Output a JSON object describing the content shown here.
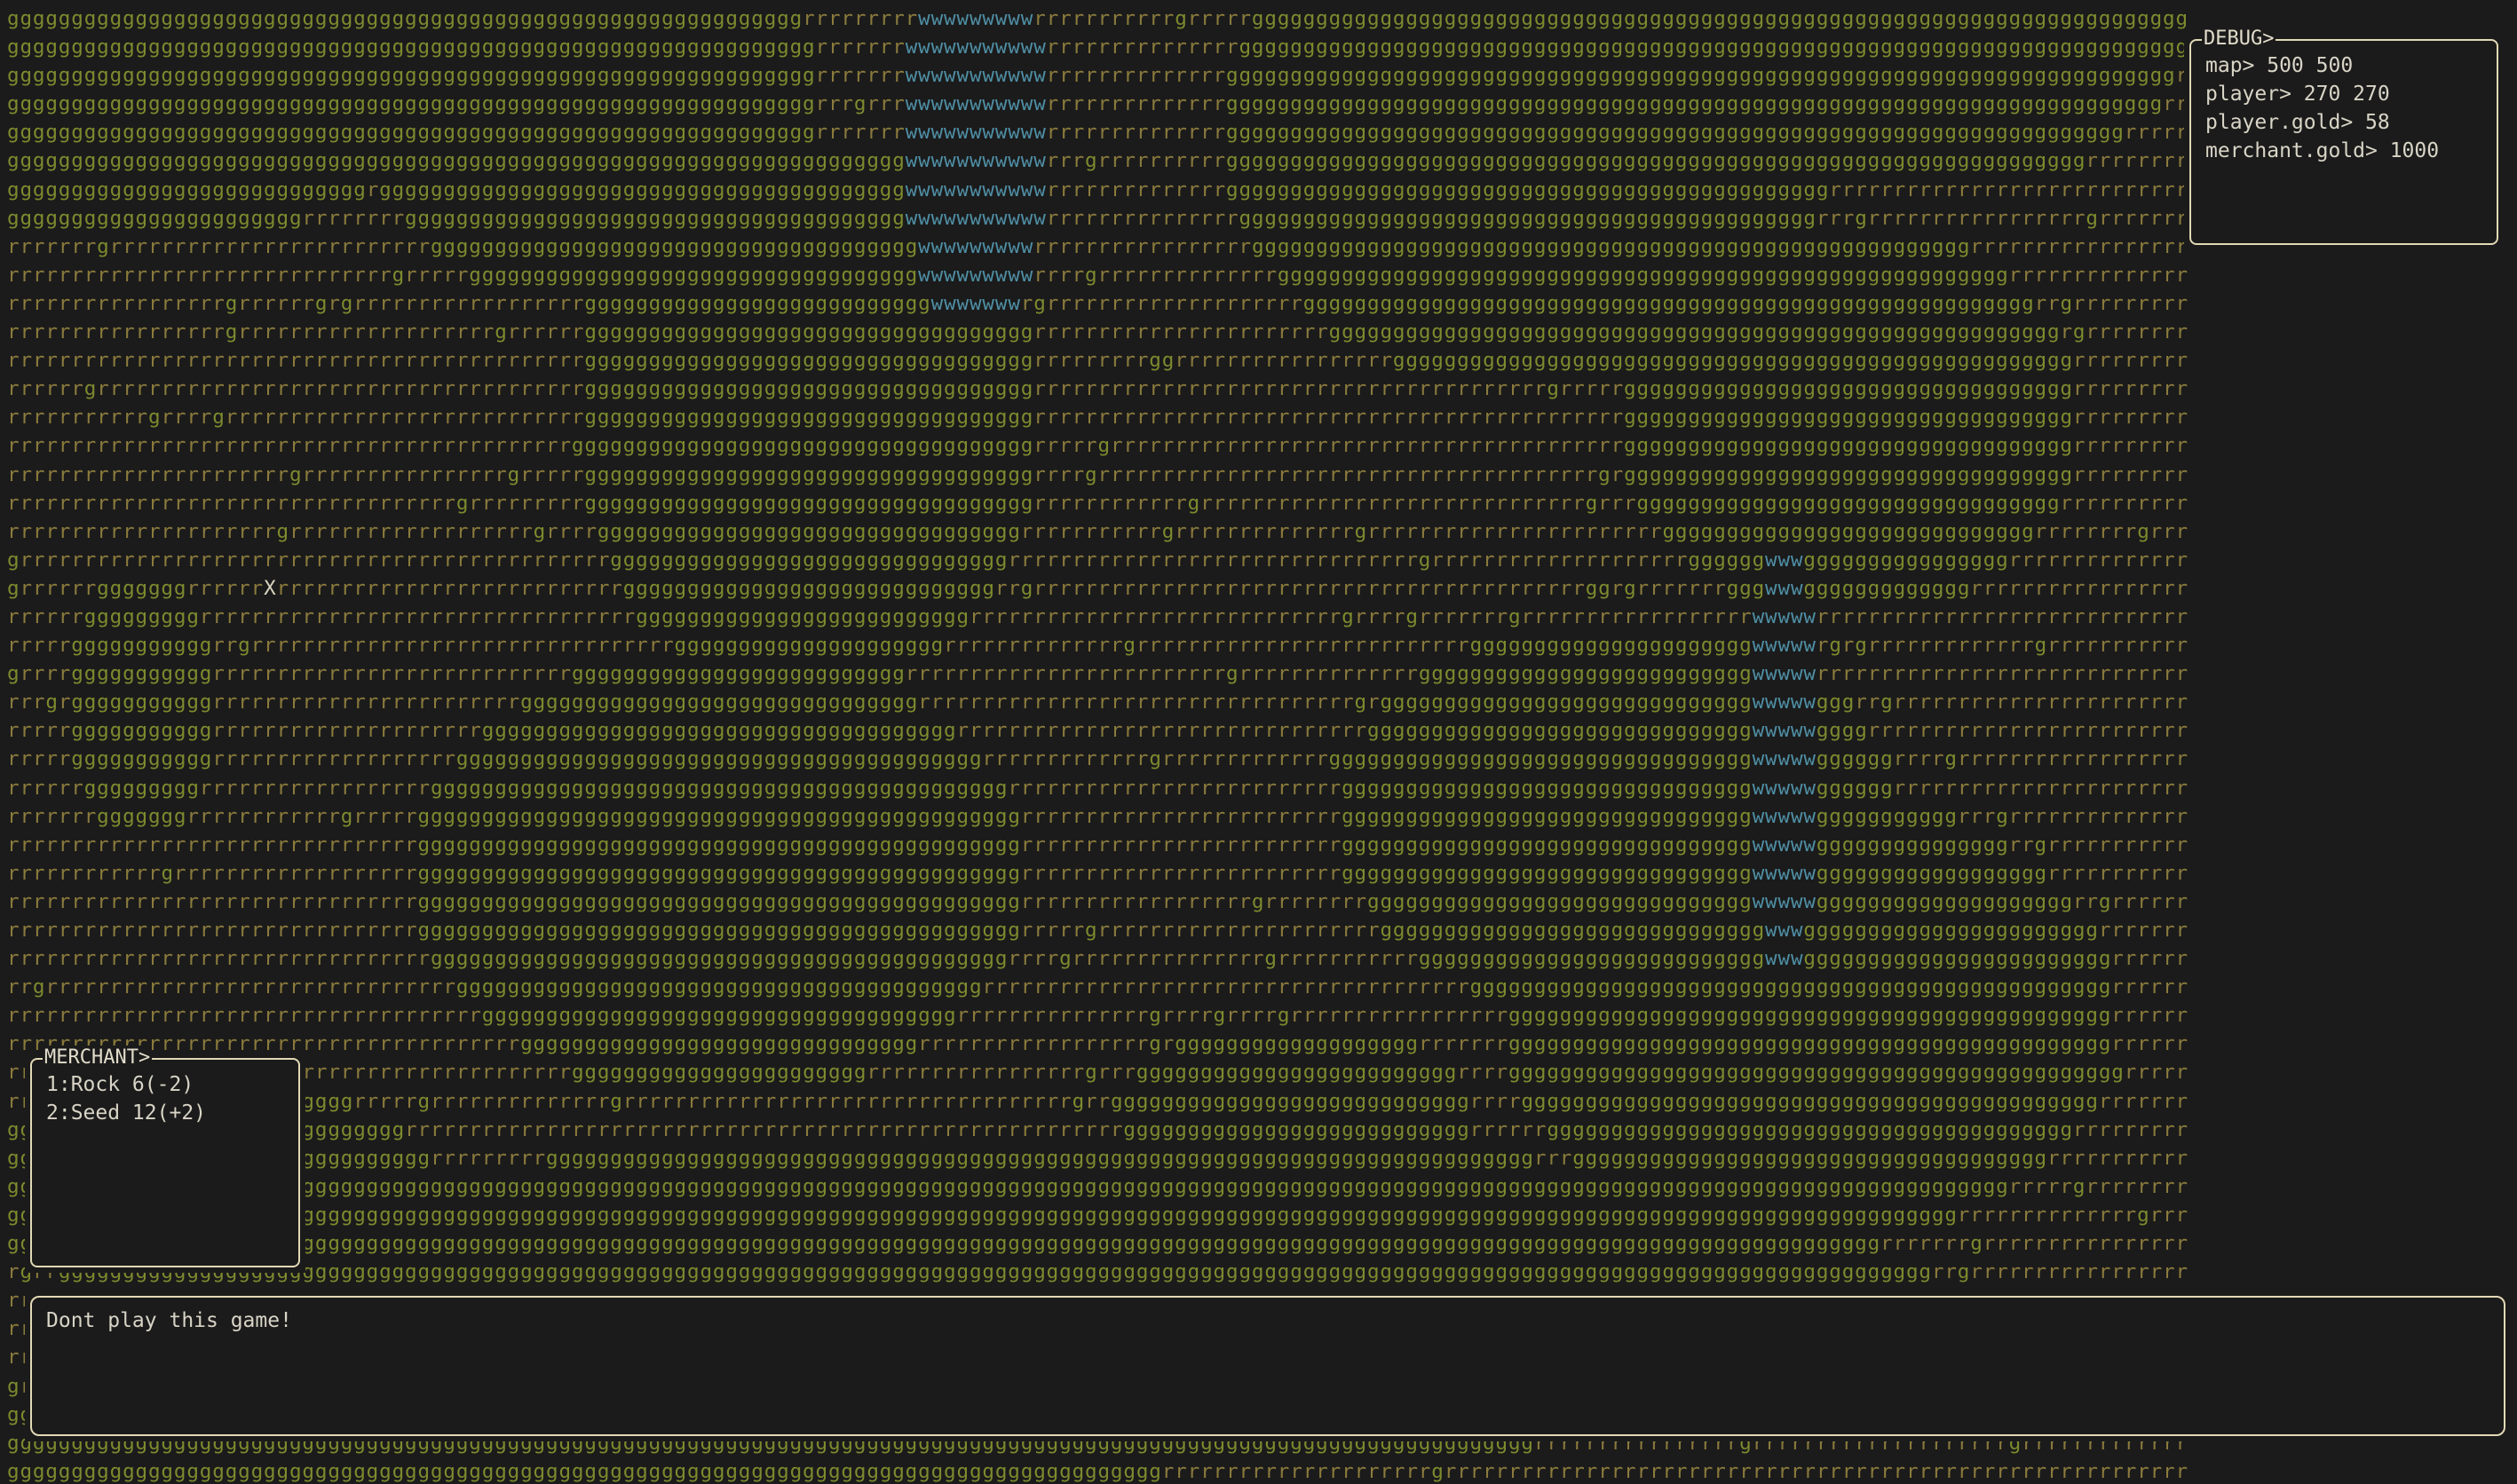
{
  "debug": {
    "title": "DEBUG>",
    "lines": [
      "map> 500 500",
      "player> 270 270",
      "player.gold> 58",
      "merchant.gold> 1000"
    ]
  },
  "merchant": {
    "title": "MERCHANT>",
    "items": [
      "1:Rock 6(-2)",
      "2:Seed 12(+2)"
    ]
  },
  "message": {
    "text": "Dont play this game!"
  },
  "player_marker": "X",
  "tile_legend": {
    "g": "grass",
    "r": "rock",
    "w": "water",
    "X": "player"
  },
  "colors": {
    "background": "#1b1b1b",
    "grass": "#7e8a2e",
    "rock": "#8a7a3c",
    "water": "#4f8fa5",
    "player": "#d8d4c0",
    "panel_border": "#e2d9b6",
    "panel_text": "#d8d4c6"
  }
}
